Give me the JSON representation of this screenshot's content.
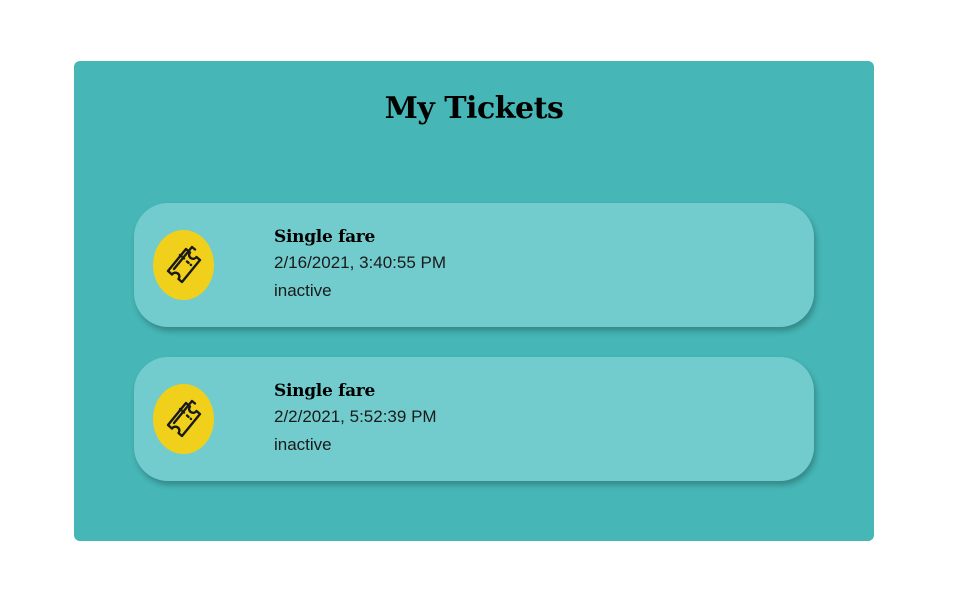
{
  "page": {
    "title": "My Tickets"
  },
  "tickets": [
    {
      "name": "Single fare",
      "date": "2/16/2021, 3:40:55 PM",
      "status": "inactive",
      "icon": "ticket-icon"
    },
    {
      "name": "Single fare",
      "date": "2/2/2021, 5:52:39 PM",
      "status": "inactive",
      "icon": "ticket-icon"
    }
  ],
  "colors": {
    "panel": "#46b6b6",
    "card": "#72cccd",
    "icon_badge": "#f0d01a"
  }
}
